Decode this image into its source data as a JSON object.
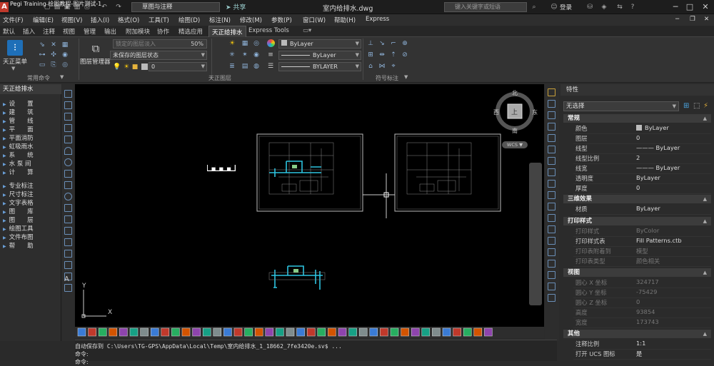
{
  "titlebar": {
    "caption": "Pegi Training 绘图教程-图片测试-1",
    "workspace": "草图与注释",
    "share": "共享",
    "document_title": "室内给排水.dwg",
    "search_placeholder": "键入关键字或短语",
    "login": "登录"
  },
  "menu": [
    "文件(F)",
    "编辑(E)",
    "视图(V)",
    "插入(I)",
    "格式(O)",
    "工具(T)",
    "绘图(D)",
    "标注(N)",
    "修改(M)",
    "参数(P)",
    "窗口(W)",
    "帮助(H)",
    "Express"
  ],
  "ribbon_tabs": [
    "默认",
    "插入",
    "注释",
    "视图",
    "管理",
    "输出",
    "附加模块",
    "协作",
    "精选应用",
    "天正给排水",
    "Express Tools"
  ],
  "active_tab": "天正给排水",
  "ribbon": {
    "tianzheng_label": "天正菜单",
    "common_panel": "常用命令",
    "layer_manager": "图层管理器",
    "layer_state_placeholder": "锁定的图层淡入",
    "layer_fade": "50%",
    "layer_state": "未保存的图层状态",
    "current_layer": "0",
    "tz_layer_panel": "天正图层",
    "color": "ByLayer",
    "linetype": "ByLayer",
    "lineweight": "BYLAYER",
    "annotation_panel": "符号标注"
  },
  "left_panel": {
    "title": "天正给排水",
    "items": [
      "设　　置",
      "建　　筑",
      "管　　线",
      "平　　面",
      "平面消防",
      "虹吸雨水",
      "系　　统",
      "水 泵 间",
      "计　　算",
      "专业标注",
      "尺寸标注",
      "文字表格",
      "图　　库",
      "图　　层",
      "绘图工具",
      "文件布图",
      "帮　　助"
    ]
  },
  "viewcube": {
    "north": "北",
    "south": "南",
    "east": "东",
    "west": "西",
    "face": "上",
    "wcs": "WCS ▼"
  },
  "canvas": {
    "label_text": "█▀█▀█▀█",
    "axis_x": "X",
    "axis_y": "Y"
  },
  "properties": {
    "title": "特性",
    "selection": "无选择",
    "sections": [
      {
        "name": "常规",
        "rows": [
          [
            "颜色",
            "ByLayer"
          ],
          [
            "图层",
            "0"
          ],
          [
            "线型",
            "——— ByLayer"
          ],
          [
            "线型比例",
            "2"
          ],
          [
            "线宽",
            "——— ByLayer"
          ],
          [
            "透明度",
            "ByLayer"
          ],
          [
            "厚度",
            "0"
          ]
        ]
      },
      {
        "name": "三维效果",
        "rows": [
          [
            "材质",
            "ByLayer"
          ]
        ]
      },
      {
        "name": "打印样式",
        "rows": [
          [
            "打印样式",
            "ByColor"
          ],
          [
            "打印样式表",
            "Fill Patterns.ctb"
          ],
          [
            "打印表附着到",
            "模型"
          ],
          [
            "打印表类型",
            "颜色相关"
          ]
        ]
      },
      {
        "name": "视图",
        "rows": [
          [
            "圆心 X 坐标",
            "324717"
          ],
          [
            "圆心 Y 坐标",
            "-75429"
          ],
          [
            "圆心 Z 坐标",
            "0"
          ],
          [
            "高度",
            "93854"
          ],
          [
            "宽度",
            "173743"
          ]
        ]
      },
      {
        "name": "其他",
        "rows": [
          [
            "注释比例",
            "1:1"
          ],
          [
            "打开 UCS 图标",
            "是"
          ]
        ]
      }
    ]
  },
  "command": {
    "history": "自动保存到 C:\\Users\\TG-GPS\\AppData\\Local\\Temp\\室内给排水_1_18662_7fe3420e.sv$ ...",
    "prompt": "命令:",
    "next": "命令:"
  }
}
